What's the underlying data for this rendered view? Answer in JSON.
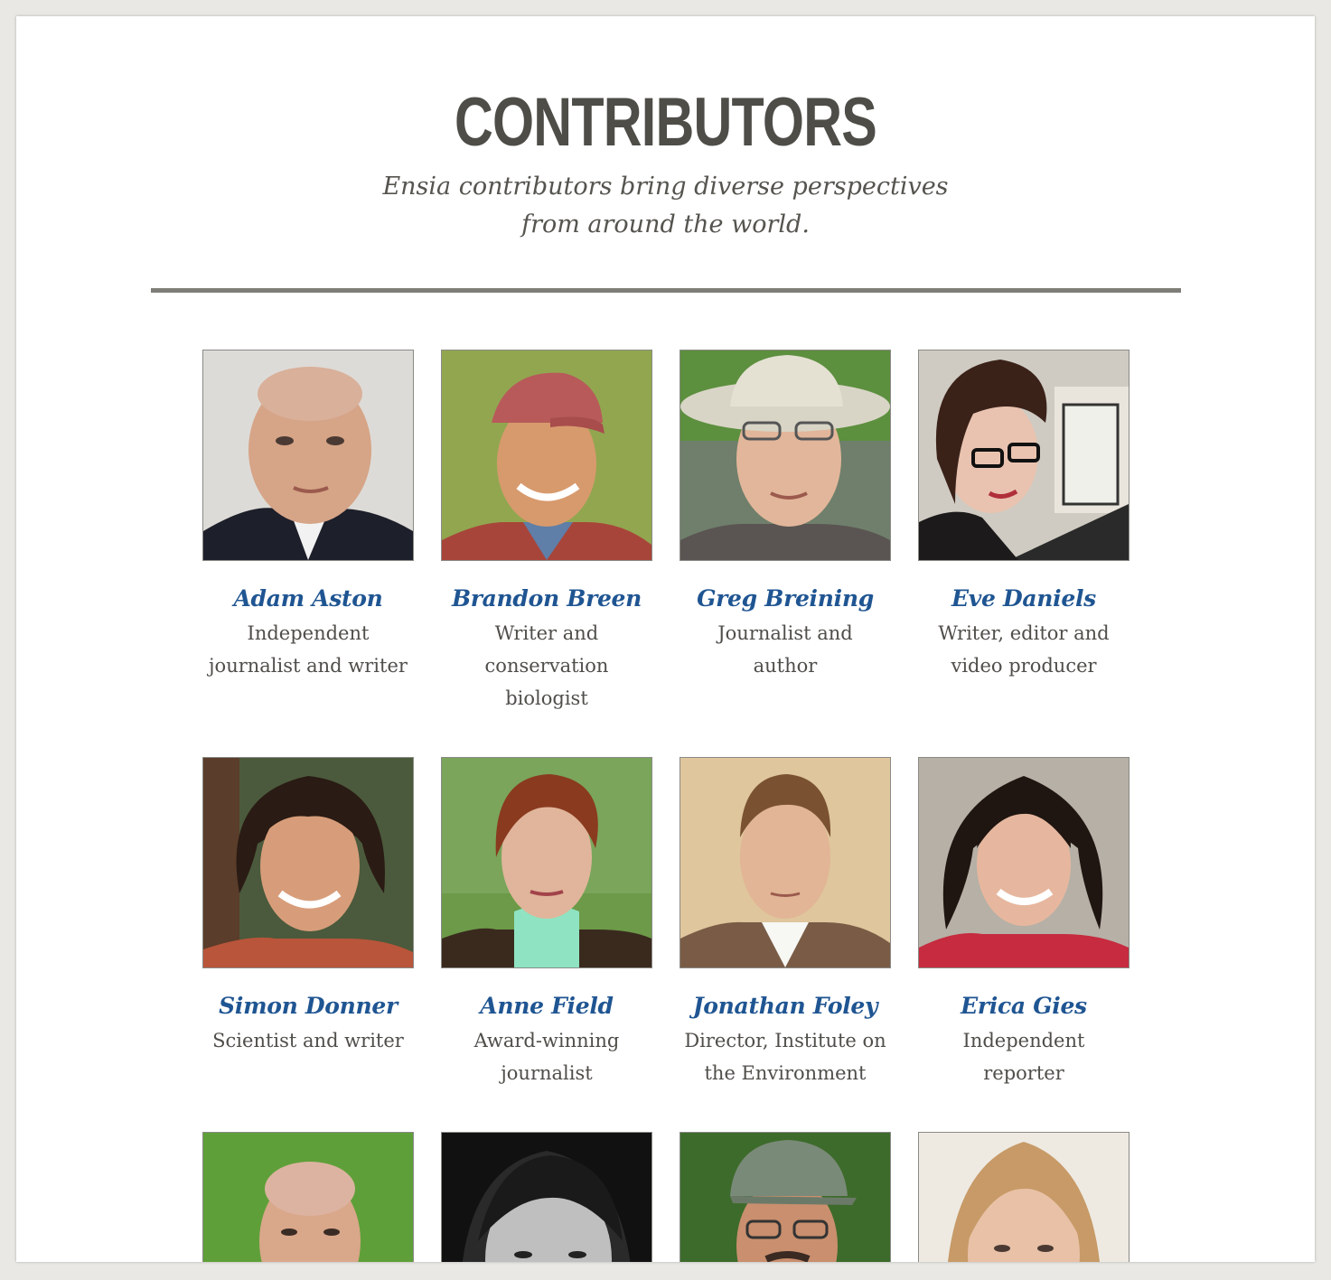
{
  "header": {
    "title": "CONTRIBUTORS",
    "subtitle_line1": "Ensia contributors bring diverse perspectives",
    "subtitle_line2": "from around the world."
  },
  "colors": {
    "name_link": "#1f5592",
    "title": "#4e4d48",
    "rule": "#7e7d78"
  },
  "contributors": [
    {
      "name": "Adam Aston",
      "role_line1": "Independent",
      "role_line2": "journalist and writer",
      "role_line3": ""
    },
    {
      "name": "Brandon Breen",
      "role_line1": "Writer and",
      "role_line2": "conservation",
      "role_line3": "biologist"
    },
    {
      "name": "Greg Breining",
      "role_line1": "Journalist and author",
      "role_line2": "",
      "role_line3": ""
    },
    {
      "name": "Eve Daniels",
      "role_line1": "Writer, editor and",
      "role_line2": "video producer",
      "role_line3": ""
    },
    {
      "name": "Simon Donner",
      "role_line1": "Scientist and writer",
      "role_line2": "",
      "role_line3": ""
    },
    {
      "name": "Anne Field",
      "role_line1": "Award-winning",
      "role_line2": "journalist",
      "role_line3": ""
    },
    {
      "name": "Jonathan Foley",
      "role_line1": "Director, Institute on",
      "role_line2": "the Environment",
      "role_line3": ""
    },
    {
      "name": "Erica Gies",
      "role_line1": "Independent",
      "role_line2": "reporter",
      "role_line3": ""
    },
    {
      "name": "",
      "role_line1": "",
      "role_line2": "",
      "role_line3": ""
    },
    {
      "name": "",
      "role_line1": "",
      "role_line2": "",
      "role_line3": ""
    },
    {
      "name": "",
      "role_line1": "",
      "role_line2": "",
      "role_line3": ""
    },
    {
      "name": "",
      "role_line1": "",
      "role_line2": "",
      "role_line3": ""
    }
  ]
}
